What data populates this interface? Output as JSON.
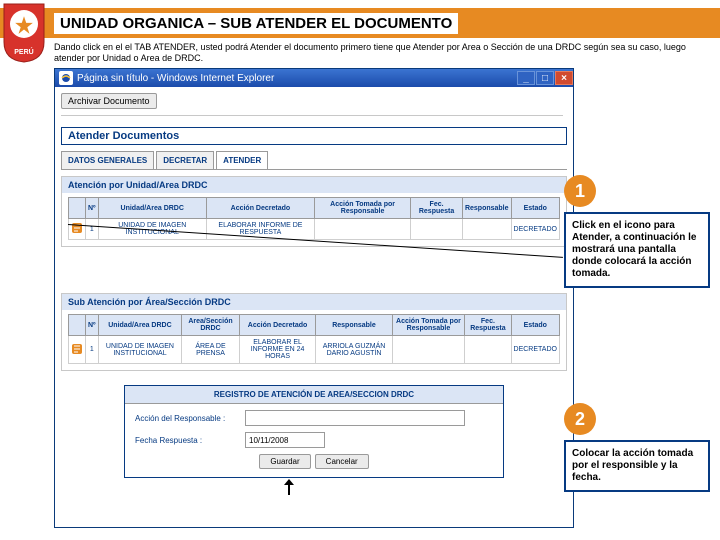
{
  "header": {
    "title": "UNIDAD ORGANICA – SUB ATENDER EL DOCUMENTO"
  },
  "intro": "Dando click en el el TAB ATENDER, usted podrá Atender el documento primero tiene que Atender por Area o Sección de una DRDC según sea su caso, luego atender por Unidad o Area de DRDC.",
  "browser": {
    "title": "Página sin título - Windows Internet Explorer",
    "min": "_",
    "max": "□",
    "close": "×"
  },
  "top_button": "Archivar Documento",
  "section_title": "Atender Documentos",
  "tabs": {
    "t1": "DATOS GENERALES",
    "t2": "DECRETAR",
    "t3": "ATENDER"
  },
  "panel1": {
    "title": "Atención por Unidad/Area DRDC",
    "headers": {
      "c0": "Nº",
      "c1": "Unidad/Area DRDC",
      "c2": "Acción Decretado",
      "c3": "Acción Tomada por Responsable",
      "c4": "Fec. Respuesta",
      "c5": "Responsable",
      "c6": "Estado"
    },
    "row": {
      "c0": "1",
      "c1": "UNIDAD DE IMAGEN INSTITUCIONAL",
      "c2": "ELABORAR INFORME DE RESPUESTA",
      "c3": "",
      "c4": "",
      "c5": "",
      "c6": "DECRETADO"
    }
  },
  "panel2": {
    "title": "Sub Atención por Área/Sección DRDC",
    "headers": {
      "c0": "Nº",
      "c1": "Unidad/Area DRDC",
      "c2": "Area/Sección DRDC",
      "c3": "Acción Decretado",
      "c4": "Responsable",
      "c5": "Acción Tomada por Responsable",
      "c6": "Fec. Respuesta",
      "c7": "Estado"
    },
    "row": {
      "c0": "1",
      "c1": "UNIDAD DE IMAGEN INSTITUCIONAL",
      "c2": "ÁREA DE PRENSA",
      "c3": "ELABORAR EL INFORME EN 24 HORAS",
      "c4": "ARRIOLA GUZMÁN DARIO AGUSTÍN",
      "c5": "",
      "c6": "",
      "c7": "DECRETADO"
    }
  },
  "registro": {
    "title": "REGISTRO DE ATENCIÓN DE AREA/SECCION DRDC",
    "l_accion": "Acción del Responsable :",
    "l_fecha": "Fecha Respuesta :",
    "v_fecha": "10/11/2008",
    "btn_save": "Guardar",
    "btn_cancel": "Cancelar"
  },
  "callouts": {
    "n1": "1",
    "t1": "Click en el icono para Atender, a continuación le mostrará una pantalla donde colocará la acción tomada.",
    "n2": "2",
    "t2": "Colocar la acción tomada por el responsible y la fecha."
  }
}
